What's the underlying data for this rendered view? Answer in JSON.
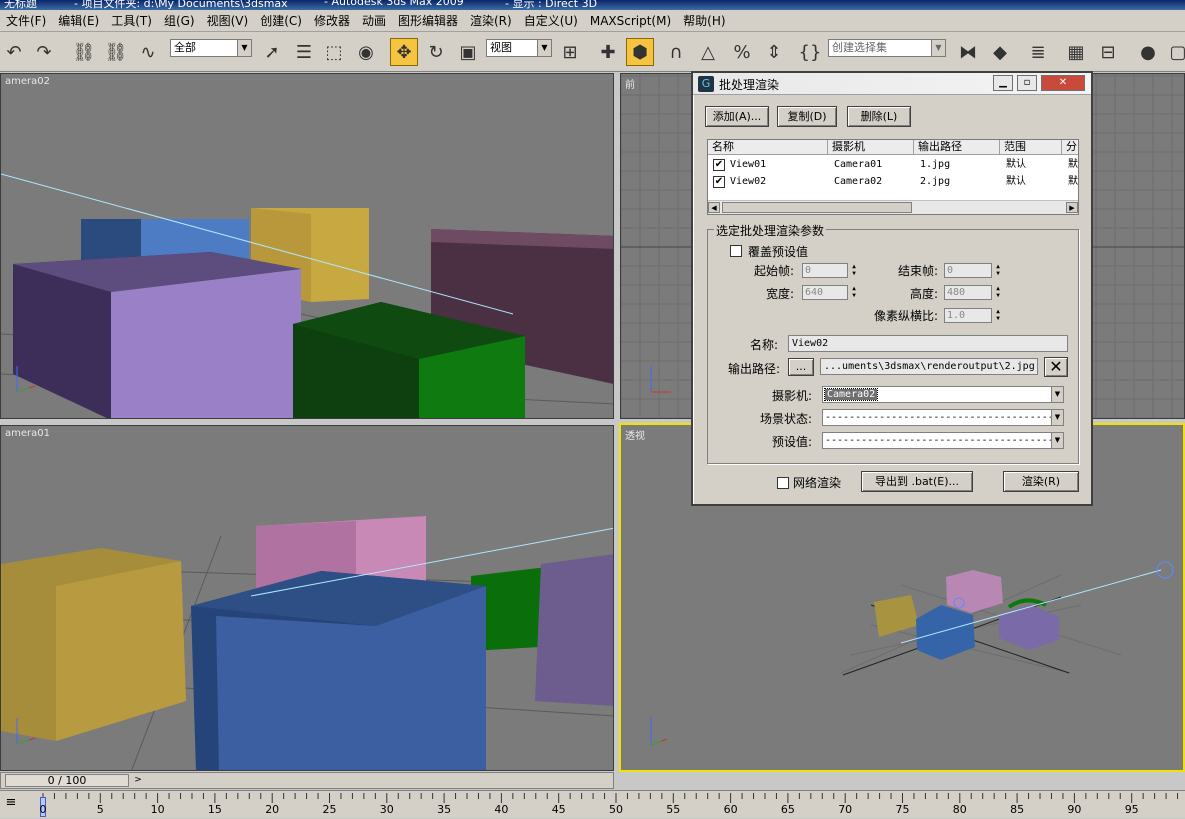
{
  "titlebar": {
    "app_title": "无标题",
    "project_folder": "- 项目文件夹: d:\\My Documents\\3dsmax",
    "product": "- Autodesk 3ds Max  2009",
    "display": "- 显示 : Direct 3D"
  },
  "menu": [
    "文件(F)",
    "编辑(E)",
    "工具(T)",
    "组(G)",
    "视图(V)",
    "创建(C)",
    "修改器",
    "动画",
    "图形编辑器",
    "渲染(R)",
    "自定义(U)",
    "MAXScript(M)",
    "帮助(H)"
  ],
  "toolbar": {
    "selection_filter": "全部",
    "reference_coord": "视图",
    "named_selection_placeholder": "创建选择集"
  },
  "viewports": {
    "top_left": "amera02",
    "top_right": "前",
    "bottom_left": "amera01",
    "bottom_right": "透视"
  },
  "dialog": {
    "title": "批处理渲染",
    "buttons": {
      "add": "添加(A)...",
      "copy": "复制(D)",
      "delete": "删除(L)",
      "network_render": "网络渲染",
      "export_bat": "导出到 .bat(E)...",
      "render": "渲染(R)"
    },
    "columns": [
      "名称",
      "摄影机",
      "输出路径",
      "范围",
      "分"
    ],
    "rows": [
      {
        "name": "View01",
        "camera": "Camera01",
        "output": "1.jpg",
        "range": "默认",
        "extra": "默",
        "checked": true
      },
      {
        "name": "View02",
        "camera": "Camera02",
        "output": "2.jpg",
        "range": "默认",
        "extra": "默",
        "checked": true
      }
    ],
    "params": {
      "group_title": "选定批处理渲染参数",
      "override_label": "覆盖预设值",
      "override_checked": false,
      "start_label": "起始帧:",
      "start_value": "0",
      "end_label": "结束帧:",
      "end_value": "0",
      "width_label": "宽度:",
      "width_value": "640",
      "height_label": "高度:",
      "height_value": "480",
      "aspect_label": "像素纵横比:",
      "aspect_value": "1.0",
      "name_label": "名称:",
      "name_value": "View02",
      "output_label": "输出路径:",
      "output_browse": "...",
      "output_value": "...uments\\3dsmax\\renderoutput\\2.jpg",
      "camera_label": "摄影机:",
      "camera_value": "Camera02",
      "scene_state_label": "场景状态:",
      "scene_state_value": "------------------------------------------------",
      "preset_label": "预设值:",
      "preset_value": "------------------------------------------------"
    },
    "network_checked": false
  },
  "timeline": {
    "frame_display": "0 / 100",
    "next_arrow": ">",
    "ticks": [
      "0",
      "5",
      "10",
      "15",
      "20",
      "25",
      "30",
      "35",
      "40",
      "45",
      "50",
      "55",
      "60",
      "65",
      "70",
      "75",
      "80",
      "85",
      "90",
      "95"
    ]
  },
  "colors": {
    "viewport_bg": "#7b7b7b",
    "active_viewport_border": "#f2e200",
    "dialog_bg": "#d4d0c8"
  }
}
